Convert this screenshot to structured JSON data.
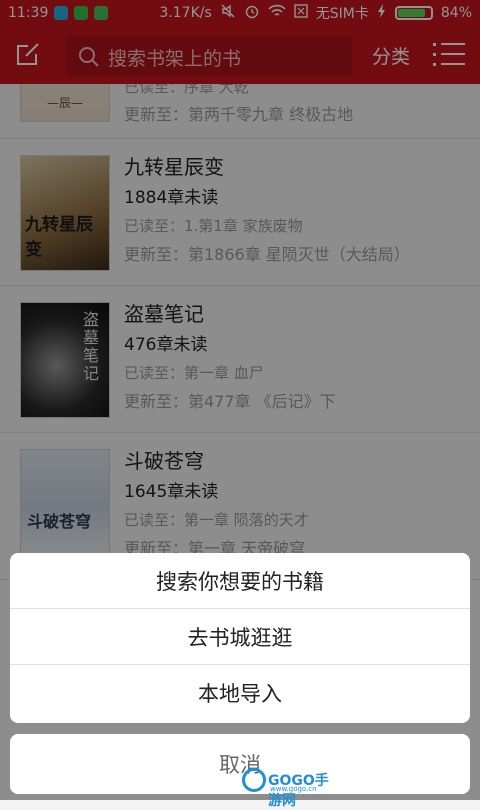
{
  "status_bar": {
    "time": "11:39",
    "speed": "3.17K/s",
    "sim": "无SIM卡",
    "battery_text": "84%",
    "battery_level": 0.84,
    "icons": [
      "notification-icon",
      "wechat-icon",
      "bookmark-icon",
      "mute-icon",
      "alarm-icon",
      "wifi-icon",
      "sim-icon",
      "charging-icon"
    ]
  },
  "toolbar": {
    "search_placeholder": "搜索书架上的书",
    "classify_label": "分类",
    "accent_color": "#c4161c"
  },
  "books": [
    {
      "title": "",
      "unread": "",
      "read_progress": "已读至：序章 大乾",
      "latest": "更新至：第两千零九章 终极古地",
      "cover_text": "—辰—"
    },
    {
      "title": "九转星辰变",
      "unread": "1884章未读",
      "read_progress": "已读至：1.第1章 家族废物",
      "latest": "更新至：第1866章 星陨灭世（大结局）",
      "cover_text": "九转星辰变"
    },
    {
      "title": "盗墓笔记",
      "unread": "476章未读",
      "read_progress": "已读至：第一章 血尸",
      "latest": "更新至：第477章 《后记》下",
      "cover_text": "盗墓笔记"
    },
    {
      "title": "斗破苍穹",
      "unread": "1645章未读",
      "read_progress": "已读至：第一章 陨落的天才",
      "latest": "更新至：第一章 天帝破穹",
      "cover_text": "斗破苍穹"
    }
  ],
  "action_sheet": {
    "options": [
      "搜索你想要的书籍",
      "去书城逛逛",
      "本地导入"
    ],
    "cancel_label": "取消"
  },
  "watermark": {
    "brand": "GOGO手游网",
    "url": "www.gogo.cn"
  }
}
